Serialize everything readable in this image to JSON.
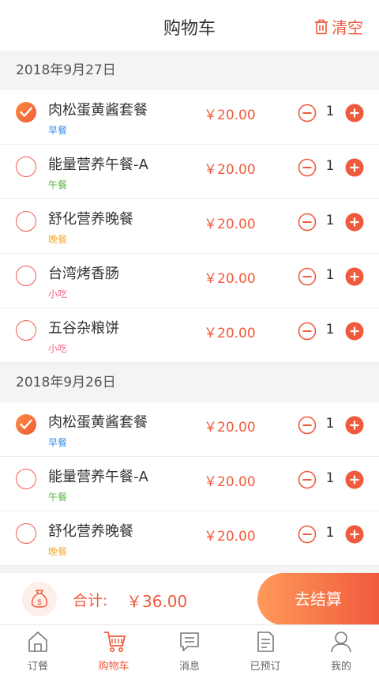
{
  "header": {
    "title": "购物车",
    "clear_label": "清空"
  },
  "groups": [
    {
      "date": "2018年9月27日",
      "items": [
        {
          "name": "肉松蛋黄酱套餐",
          "tag": "早餐",
          "tag_color": "#3b8de3",
          "price": "￥20.00",
          "qty": "1",
          "checked": true
        },
        {
          "name": "能量营养午餐-A",
          "tag": "午餐",
          "tag_color": "#5cb84a",
          "price": "￥20.00",
          "qty": "1",
          "checked": false
        },
        {
          "name": "舒化营养晚餐",
          "tag": "晚餐",
          "tag_color": "#f3ac3c",
          "price": "￥20.00",
          "qty": "1",
          "checked": false
        },
        {
          "name": "台湾烤香肠",
          "tag": "小吃",
          "tag_color": "#ef6a8a",
          "price": "￥20.00",
          "qty": "1",
          "checked": false
        },
        {
          "name": "五谷杂粮饼",
          "tag": "小吃",
          "tag_color": "#ef6a8a",
          "price": "￥20.00",
          "qty": "1",
          "checked": false
        }
      ]
    },
    {
      "date": "2018年9月26日",
      "items": [
        {
          "name": "肉松蛋黄酱套餐",
          "tag": "早餐",
          "tag_color": "#3b8de3",
          "price": "￥20.00",
          "qty": "1",
          "checked": true
        },
        {
          "name": "能量营养午餐-A",
          "tag": "午餐",
          "tag_color": "#5cb84a",
          "price": "￥20.00",
          "qty": "1",
          "checked": false
        },
        {
          "name": "舒化营养晚餐",
          "tag": "晚餐",
          "tag_color": "#f3ac3c",
          "price": "￥20.00",
          "qty": "1",
          "checked": false
        }
      ]
    }
  ],
  "checkout": {
    "total_label": "合计:",
    "total_value": "￥36.00",
    "button_label": "去结算"
  },
  "tabs": [
    {
      "label": "订餐",
      "icon": "home-icon",
      "active": false
    },
    {
      "label": "购物车",
      "icon": "cart-icon",
      "active": true
    },
    {
      "label": "消息",
      "icon": "message-icon",
      "active": false
    },
    {
      "label": "已预订",
      "icon": "orders-icon",
      "active": false
    },
    {
      "label": "我的",
      "icon": "user-icon",
      "active": false
    }
  ],
  "colors": {
    "accent": "#f05a3c",
    "accent_light": "#ff9a5a",
    "page_bg": "#f4f4f4"
  }
}
